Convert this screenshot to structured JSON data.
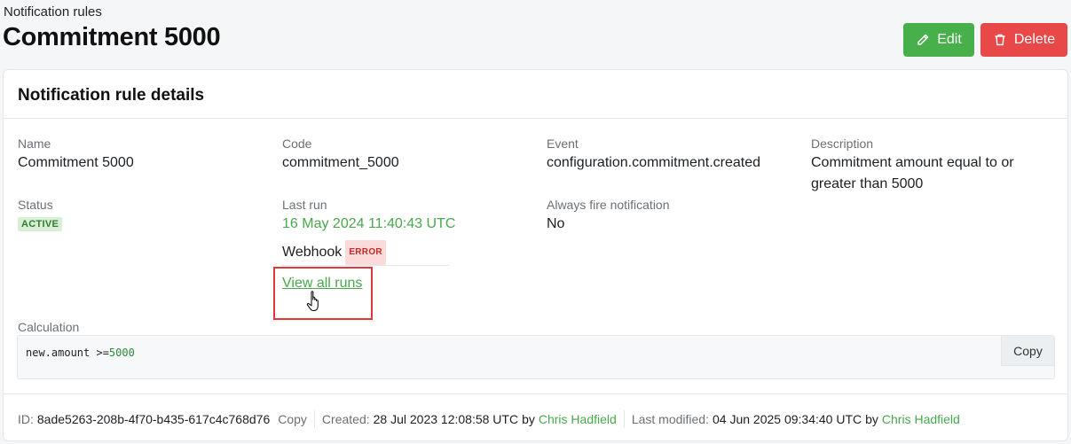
{
  "header": {
    "breadcrumb": "Notification rules",
    "title": "Commitment 5000",
    "edit_label": "Edit",
    "delete_label": "Delete"
  },
  "card": {
    "title": "Notification rule details",
    "fields": {
      "name_label": "Name",
      "name_value": "Commitment 5000",
      "code_label": "Code",
      "code_value": "commitment_5000",
      "event_label": "Event",
      "event_value": "configuration.commitment.created",
      "description_label": "Description",
      "description_line1": "Commitment amount equal to or",
      "description_line2": "greater than 5000",
      "status_label": "Status",
      "status_value": "ACTIVE",
      "last_run_label": "Last run",
      "last_run_value": "16 May 2024 11:40:43 UTC",
      "webhook_label": "Webhook",
      "webhook_status": "ERROR",
      "view_all_runs": "View all runs",
      "always_fire_label": "Always fire notification",
      "always_fire_value": "No"
    },
    "calculation": {
      "label": "Calculation",
      "code_prefix": "new.amount >=",
      "code_number": "5000",
      "copy_label": "Copy"
    },
    "footer": {
      "id_label": "ID:",
      "id_value": "8ade5263-208b-4f70-b435-617c4c768d76",
      "copy_label": "Copy",
      "created_label": "Created:",
      "created_value": "28 Jul 2023 12:08:58 UTC",
      "created_by_label": "by",
      "created_by": "Chris Hadfield",
      "modified_label": "Last modified:",
      "modified_value": "04 Jun 2025 09:34:40 UTC",
      "modified_by_label": "by",
      "modified_by": "Chris Hadfield"
    }
  },
  "colors": {
    "accent_green": "#48a84b",
    "edit_button": "#48b04b",
    "delete_button": "#e94848",
    "highlight_border": "#e0383b"
  },
  "icons": {
    "edit": "pencil-icon",
    "delete": "trash-icon",
    "cursor": "hand-pointer-icon"
  }
}
